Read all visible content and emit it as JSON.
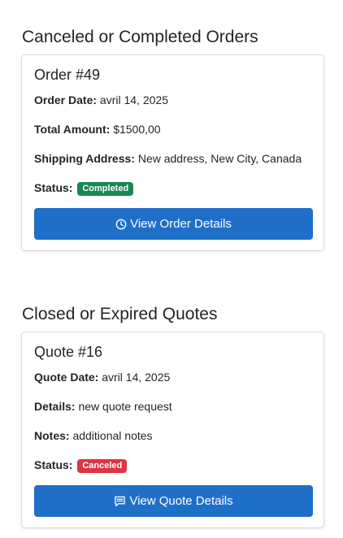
{
  "orders_section": {
    "title": "Canceled or Completed Orders",
    "card": {
      "title": "Order #49",
      "order_date_label": "Order Date:",
      "order_date": "avril 14, 2025",
      "total_label": "Total Amount:",
      "total": "$1500,00",
      "shipping_label": "Shipping Address:",
      "shipping": "New address, New City, Canada",
      "status_label": "Status:",
      "status": "Completed",
      "status_color": "#198754",
      "button_icon": "clock-icon",
      "button_label": "View Order Details"
    }
  },
  "quotes_section": {
    "title": "Closed or Expired Quotes",
    "card": {
      "title": "Quote #16",
      "quote_date_label": "Quote Date:",
      "quote_date": "avril 14, 2025",
      "details_label": "Details:",
      "details": "new quote request",
      "notes_label": "Notes:",
      "notes": "additional notes",
      "status_label": "Status:",
      "status": "Canceled",
      "status_color": "#dc3545",
      "button_icon": "message-icon",
      "button_label": "View Quote Details"
    }
  },
  "colors": {
    "button": "#1f6fc9"
  }
}
